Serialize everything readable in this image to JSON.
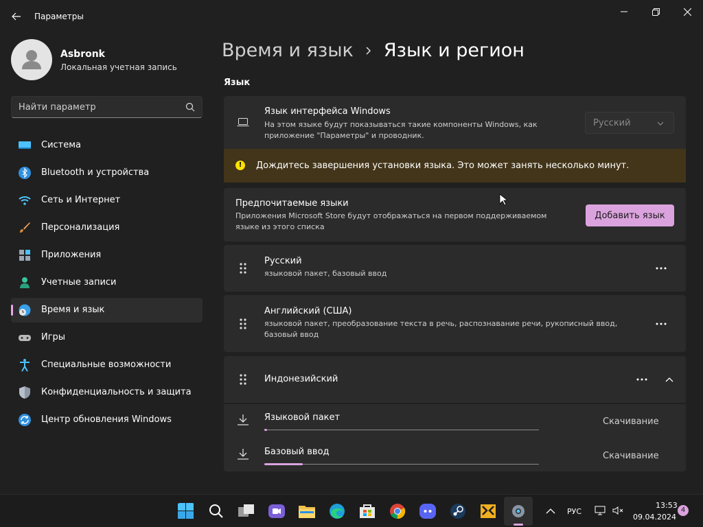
{
  "window": {
    "title": "Параметры"
  },
  "user": {
    "name": "Asbronk",
    "account_type": "Локальная учетная запись"
  },
  "search": {
    "placeholder": "Найти параметр"
  },
  "sidebar": {
    "items": [
      {
        "label": "Система",
        "icon": "system-icon"
      },
      {
        "label": "Bluetooth и устройства",
        "icon": "bluetooth-icon"
      },
      {
        "label": "Сеть и Интернет",
        "icon": "wifi-icon"
      },
      {
        "label": "Персонализация",
        "icon": "brush-icon"
      },
      {
        "label": "Приложения",
        "icon": "apps-icon"
      },
      {
        "label": "Учетные записи",
        "icon": "person-icon"
      },
      {
        "label": "Время и язык",
        "icon": "globe-clock-icon",
        "active": true
      },
      {
        "label": "Игры",
        "icon": "gamepad-icon"
      },
      {
        "label": "Специальные возможности",
        "icon": "accessibility-icon"
      },
      {
        "label": "Конфиденциальность и защита",
        "icon": "shield-icon"
      },
      {
        "label": "Центр обновления Windows",
        "icon": "update-icon"
      }
    ]
  },
  "breadcrumb": {
    "parent": "Время и язык",
    "current": "Язык и регион"
  },
  "language_section": {
    "heading": "Язык",
    "display_language": {
      "title": "Язык интерфейса Windows",
      "description": "На этом языке будут показываться такие компоненты Windows, как приложение \"Параметры\" и проводник.",
      "value": "Русский"
    },
    "warning": "Дождитесь завершения установки языка. Это может занять несколько минут.",
    "preferred": {
      "title": "Предпочитаемые языки",
      "description": "Приложения Microsoft Store будут отображаться на первом поддерживаемом языке из этого списка",
      "add_button": "Добавить язык"
    },
    "languages": [
      {
        "name": "Русский",
        "features": "языковой пакет, базовый ввод"
      },
      {
        "name": "Английский (США)",
        "features": "языковой пакет, преобразование текста в речь, распознавание речи, рукописный ввод, базовый ввод"
      },
      {
        "name": "Индонезийский",
        "features": ""
      }
    ],
    "downloads": [
      {
        "title": "Языковой пакет",
        "status": "Скачивание",
        "progress": 0.01
      },
      {
        "title": "Базовый ввод",
        "status": "Скачивание",
        "progress": 0.14
      }
    ]
  },
  "taskbar": {
    "apps": [
      "start-icon",
      "search-icon",
      "task-view-icon",
      "chat-icon",
      "file-explorer-icon",
      "edge-icon",
      "store-icon",
      "chrome-icon",
      "discord-icon",
      "steam-icon",
      "app-icon",
      "settings-icon"
    ],
    "language_indicator": "РУС",
    "time": "13:53",
    "date": "09.04.2024",
    "notifications": "4"
  },
  "colors": {
    "accent": "#dba3de",
    "warning_bg": "#433519",
    "warning_icon": "#fce100"
  }
}
